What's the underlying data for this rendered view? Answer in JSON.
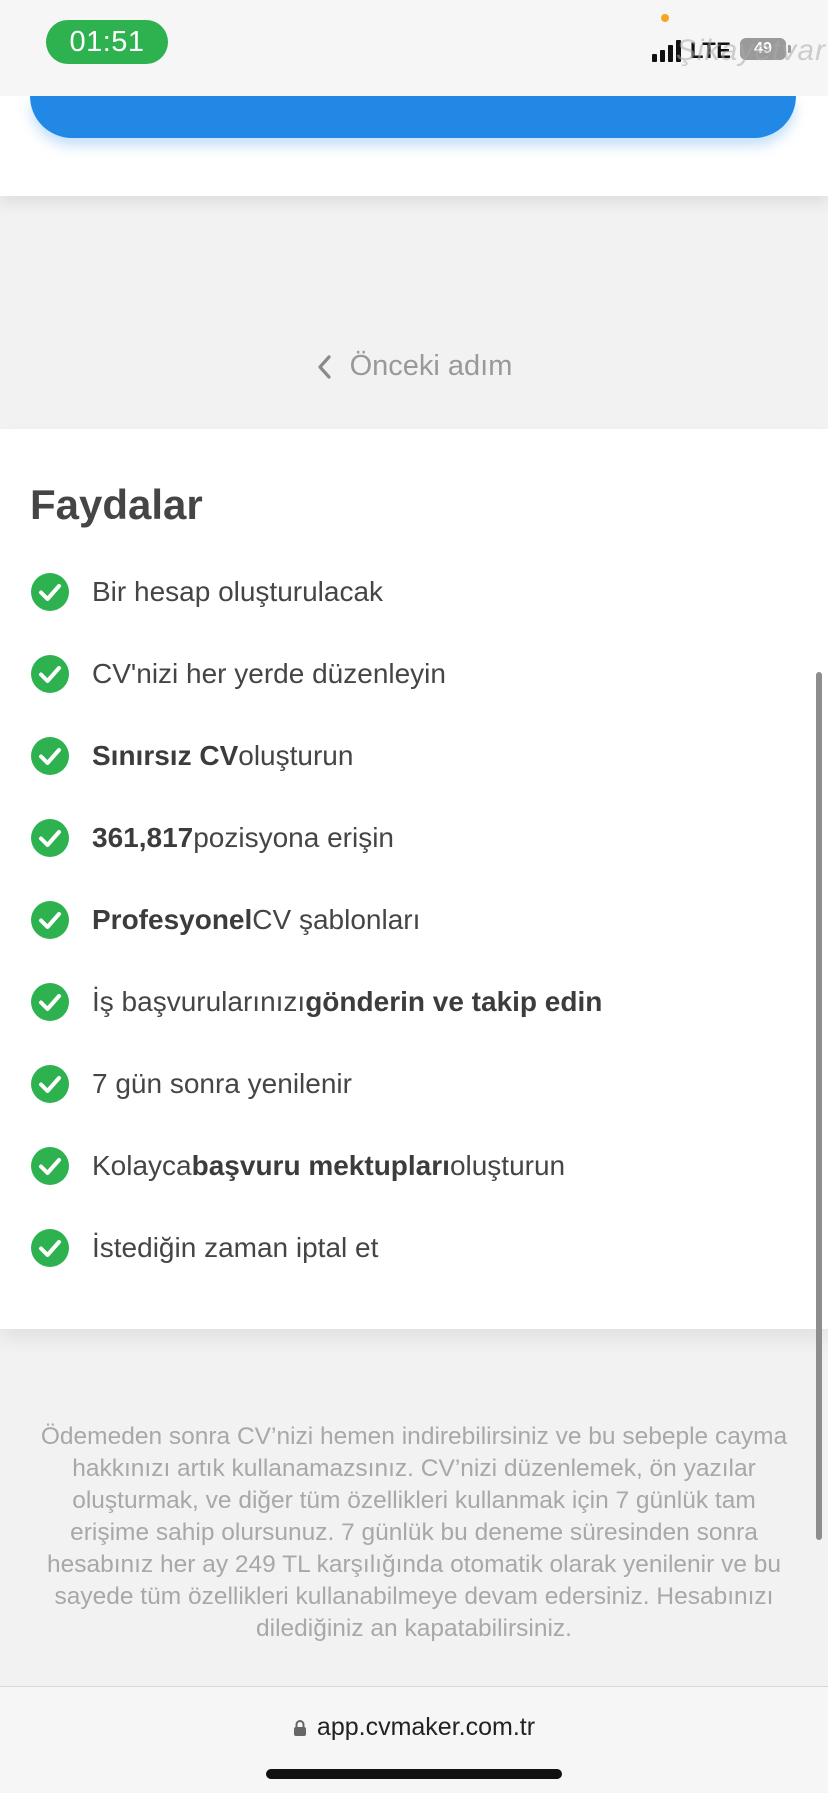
{
  "status_bar": {
    "time": "01:51",
    "network": "LTE",
    "battery": "49",
    "watermark": "Şikayetvar"
  },
  "navigation": {
    "previous_step": "Önceki adım"
  },
  "benefits": {
    "title": "Faydalar",
    "items": [
      {
        "pre": "Bir hesap oluşturulacak",
        "bold": "",
        "post": ""
      },
      {
        "pre": "CV'nizi her yerde düzenleyin",
        "bold": "",
        "post": ""
      },
      {
        "pre": "",
        "bold": "Sınırsız CV",
        "post": " oluşturun"
      },
      {
        "pre": "",
        "bold": "361,817",
        "post": " pozisyona erişin"
      },
      {
        "pre": "",
        "bold": "Profesyonel",
        "post": " CV şablonları"
      },
      {
        "pre": "İş başvurularınızı ",
        "bold": "gönderin ve takip edin",
        "post": ""
      },
      {
        "pre": "7 gün sonra yenilenir",
        "bold": "",
        "post": ""
      },
      {
        "pre": "Kolayca ",
        "bold": "başvuru mektupları",
        "post": " oluşturun"
      },
      {
        "pre": "İstediğin zaman iptal et",
        "bold": "",
        "post": ""
      }
    ]
  },
  "disclaimer": "Ödemeden sonra CV’nizi hemen indirebilirsiniz ve bu sebeple cayma hakkınızı artık kullanamazsınız. CV’nizi düzenlemek, ön yazılar oluşturmak, ve diğer tüm özellikleri kullanmak için 7 günlük tam erişime sahip olursunuz. 7 günlük bu deneme süresinden sonra hesabınız her ay 249 TL karşılığında otomatik olarak yenilenir ve bu sayede tüm özellikleri kullanabilmeye devam edersiniz. Hesabınızı dilediğiniz an kapatabilirsiniz.",
  "browser": {
    "url": "app.cvmaker.com.tr"
  },
  "colors": {
    "primary_button": "#2188e6",
    "check_green": "#2db24f",
    "time_pill": "#2db24f"
  }
}
